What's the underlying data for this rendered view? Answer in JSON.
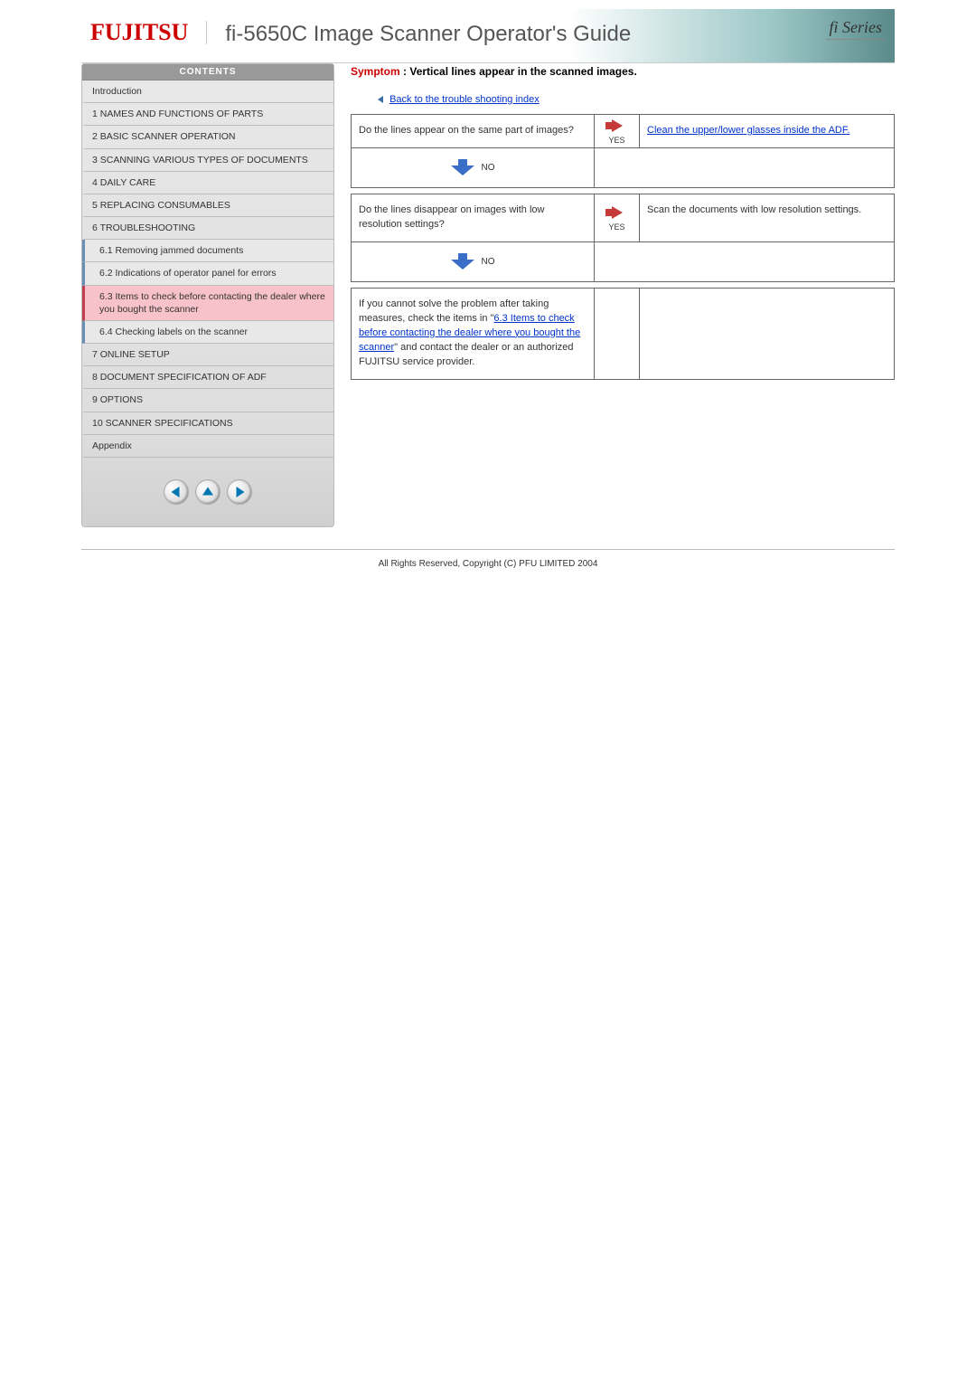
{
  "header": {
    "brand": "FUJITSU",
    "title": "fi-5650C Image Scanner Operator's Guide",
    "series": "fi Series"
  },
  "sidebar": {
    "contents_label": "CONTENTS",
    "items": [
      "Introduction",
      "1 NAMES AND FUNCTIONS OF PARTS",
      "2 BASIC SCANNER OPERATION",
      "3 SCANNING VARIOUS TYPES OF DOCUMENTS",
      "4 DAILY CARE",
      "5 REPLACING CONSUMABLES",
      "6 TROUBLESHOOTING"
    ],
    "subitems": [
      "6.1 Removing jammed documents",
      "6.2 Indications of operator panel for errors",
      "6.3 Items to check before contacting the dealer where you bought the scanner",
      "6.4 Checking labels on the scanner"
    ],
    "items_after": [
      "7 ONLINE SETUP",
      "8 DOCUMENT SPECIFICATION OF ADF",
      "9 OPTIONS",
      "10 SCANNER SPECIFICATIONS",
      "Appendix"
    ]
  },
  "content": {
    "symptom_label": "Symptom",
    "symptom_text": " : Vertical lines appear in the scanned images.",
    "back_link": "Back to the trouble shooting index",
    "q1": "Do the lines appear on the same part of images?",
    "yes": "YES",
    "a1": "Clean the upper/lower glasses inside the ADF.",
    "no": "NO",
    "q2": "Do the lines disappear on images with low resolution settings?",
    "a2": "Scan the documents with low resolution settings.",
    "final_pre": "If you cannot solve the problem after taking measures, check the items in \"",
    "final_link": "6.3 Items to check before contacting the dealer where you bought the scanner",
    "final_post": "\" and contact the dealer or an authorized FUJITSU service provider."
  },
  "footer": "All Rights Reserved, Copyright (C) PFU LIMITED 2004"
}
